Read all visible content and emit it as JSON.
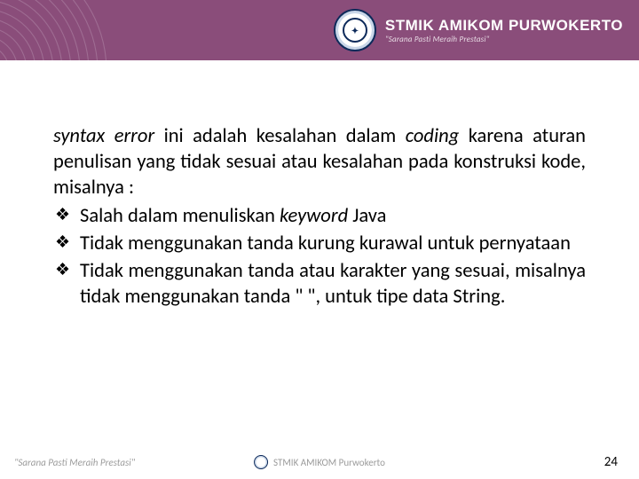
{
  "header": {
    "brand": "STMIK AMIKOM PURWOKERTO",
    "tagline": "\"Sarana Pasti Meraih Prestasi\"",
    "logo_abbrev": "✦"
  },
  "body": {
    "lead_italic_1": "syntax error",
    "lead_plain_1": " ini adalah kesalahan dalam ",
    "lead_italic_2": "coding",
    "lead_plain_2": " karena aturan penulisan yang tidak sesuai atau kesalahan pada konstruksi kode, misalnya :",
    "bullet1_pre": " Salah dalam menuliskan ",
    "bullet1_italic": "keyword",
    "bullet1_post": " Java",
    "bullet2": " Tidak menggunakan tanda kurung kurawal untuk pernyataan",
    "bullet3": " Tidak menggunakan tanda atau karakter yang sesuai, misalnya tidak menggunakan tanda \" \", untuk tipe data String."
  },
  "footer": {
    "left": "\"Sarana Pasti Meraih Prestasi\"",
    "center": "STMIK AMIKOM Purwokerto",
    "page": "24"
  }
}
